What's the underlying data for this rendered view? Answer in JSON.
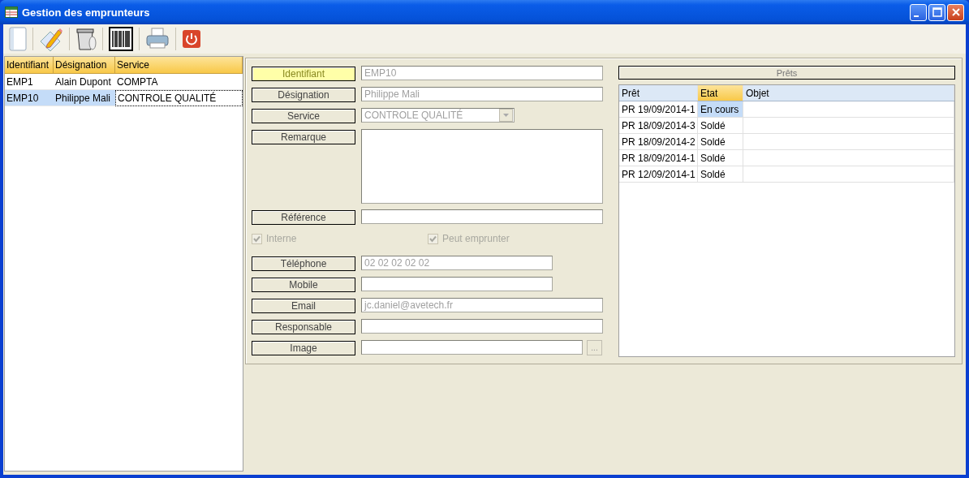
{
  "window": {
    "title": "Gestion des emprunteurs"
  },
  "employees": {
    "columns": [
      {
        "label": "Identifiant"
      },
      {
        "label": "Désignation"
      },
      {
        "label": "Service"
      }
    ],
    "rows": [
      {
        "cells": [
          "EMP1",
          "Alain Dupont",
          "COMPTA"
        ],
        "selected": false
      },
      {
        "cells": [
          "EMP10",
          "Philippe Mali",
          "CONTROLE QUALITÉ"
        ],
        "selected": true
      }
    ]
  },
  "form": [
    {
      "kind": "text",
      "label": "Identifiant",
      "value": "EMP10",
      "focused": true
    },
    {
      "kind": "text",
      "label": "Désignation",
      "value": "Philippe Mali",
      "focused": false
    },
    {
      "kind": "combo",
      "label": "Service",
      "value": "CONTROLE QUALITÉ",
      "focused": false
    },
    {
      "kind": "textarea",
      "label": "Remarque",
      "focused": false
    },
    {
      "kind": "text",
      "label": "Référence",
      "focused": false
    },
    {
      "kind": "checks",
      "items": [
        {
          "label": "Interne",
          "checked": true
        },
        {
          "label": "Peut emprunter",
          "checked": true
        }
      ]
    },
    {
      "kind": "short",
      "label": "Téléphone",
      "value": "02 02 02 02 02",
      "focused": false
    },
    {
      "kind": "short",
      "label": "Mobile",
      "focused": false
    },
    {
      "kind": "text",
      "label": "Email",
      "value": "jc.daniel@avetech.fr",
      "focused": false
    },
    {
      "kind": "text",
      "label": "Responsable",
      "focused": false
    },
    {
      "kind": "file",
      "label": "Image",
      "button": "...",
      "focused": false
    }
  ],
  "loans": {
    "title": "Prêts",
    "columns": [
      {
        "label": "Prêt",
        "selected": false
      },
      {
        "label": "Etat",
        "selected": true
      },
      {
        "label": "Objet",
        "selected": false
      }
    ],
    "rows": [
      {
        "cells": [
          "PR 19/09/2014-1",
          "En cours"
        ],
        "selected": true
      },
      {
        "cells": [
          "PR 18/09/2014-3",
          "Soldé"
        ],
        "selected": false
      },
      {
        "cells": [
          "PR 18/09/2014-2",
          "Soldé"
        ],
        "selected": false
      },
      {
        "cells": [
          "PR 18/09/2014-1",
          "Soldé"
        ],
        "selected": false
      },
      {
        "cells": [
          "PR 12/09/2014-1",
          "Soldé"
        ],
        "selected": false
      }
    ]
  }
}
